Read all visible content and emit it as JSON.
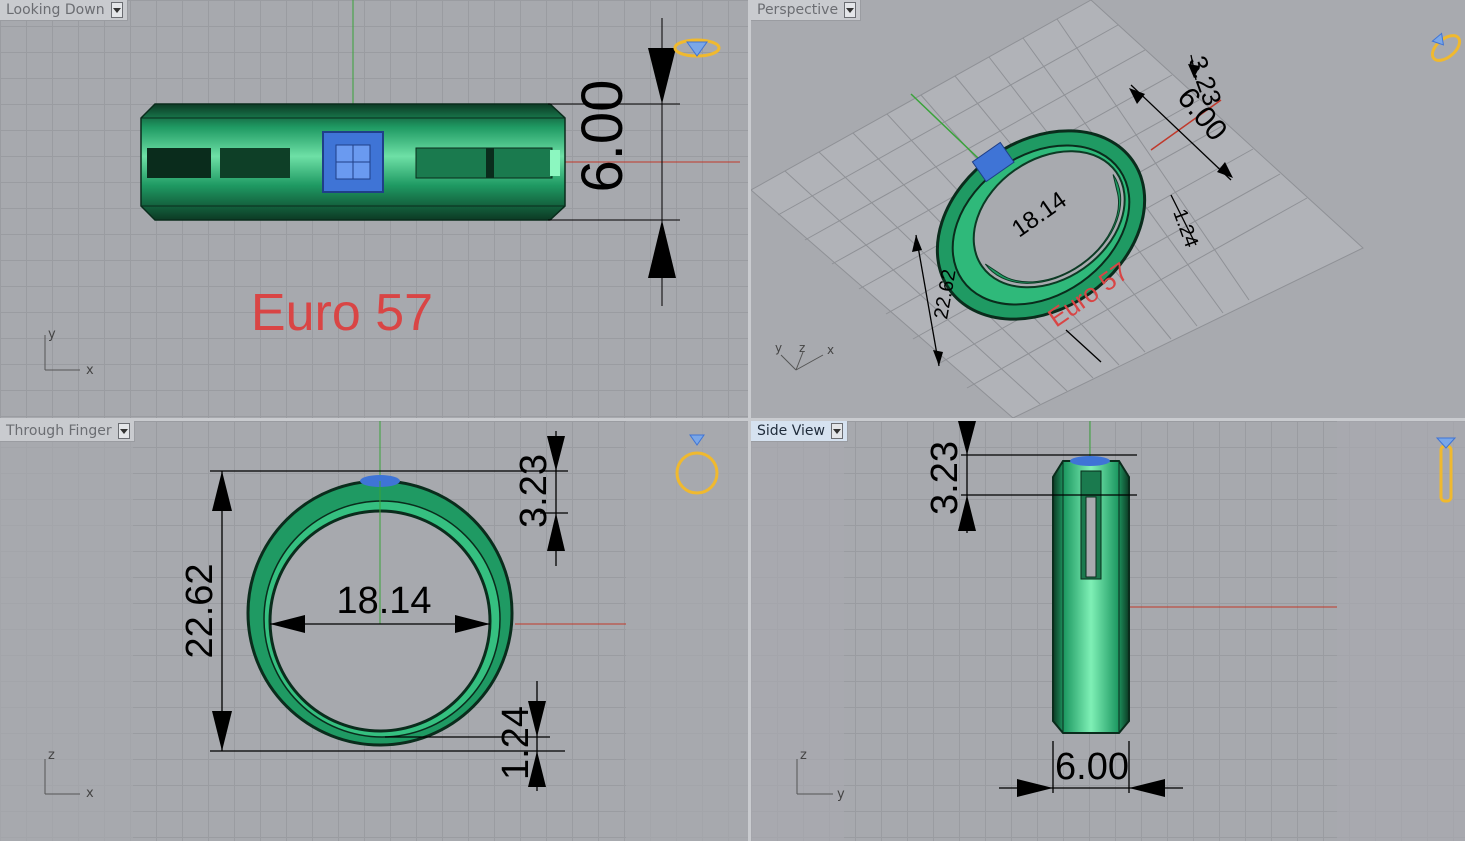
{
  "viewports": {
    "top_left": {
      "label": "Looking Down",
      "annotation": "Euro 57",
      "dims": {
        "width": "6.00"
      },
      "axes": {
        "a": "y",
        "b": "x"
      }
    },
    "top_right": {
      "label": "Perspective",
      "annotation": "Euro 57",
      "dims": {
        "a": "3.23",
        "b": "6.00",
        "c": "18.14",
        "d": "1.24",
        "e": "22.62"
      },
      "axes": {
        "a": "y",
        "b": "z",
        "c": "x"
      }
    },
    "bottom_left": {
      "label": "Through Finger",
      "dims": {
        "outer": "22.62",
        "inner": "18.14",
        "top": "3.23",
        "bottom": "1.24"
      },
      "axes": {
        "a": "z",
        "b": "x"
      }
    },
    "bottom_right": {
      "label": "Side View",
      "dims": {
        "top": "3.23",
        "width": "6.00"
      },
      "axes": {
        "a": "z",
        "b": "y"
      }
    }
  },
  "colors": {
    "ring_green": "#1f9a63",
    "ring_dark": "#0c3a24",
    "stone_blue": "#3f74d6",
    "axis_green": "#3aa33a",
    "axis_red": "#c0392b",
    "annotation_red": "#d94545",
    "gizmo_gold": "#f0b92e"
  },
  "icons": [
    "ring-top-gizmo-icon",
    "ring-perspective-gizmo-icon",
    "ring-front-gizmo-icon",
    "ring-side-gizmo-icon"
  ]
}
